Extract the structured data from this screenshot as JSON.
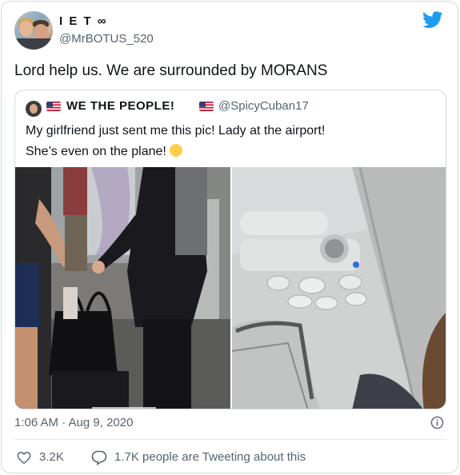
{
  "author": {
    "display_name": "I E T ∞",
    "handle": "@MrBOTUS_520",
    "avatar": "avatar-couple"
  },
  "brand_icon": "twitter-bird-icon",
  "tweet_text": "Lord help us. We are surrounded by MORANS",
  "quoted_tweet": {
    "display_name": "WE THE PEOPLE!",
    "flag_icon": "us-flag-icon",
    "handle": "@SpicyCuban17",
    "text_line1": "My girlfriend just sent me this pic!  Lady at the airport!",
    "text_line2": "She’s even on the plane!",
    "emoji": "rolling-on-floor-laughing-emoji",
    "photos": [
      "airport-lady-photo",
      "airplane-ceiling-photo"
    ]
  },
  "timestamp": "1:06 AM · Aug 9, 2020",
  "info_icon": "info-icon",
  "actions": {
    "likes": "3.2K",
    "replies_text": "1.7K people are Tweeting about this"
  },
  "colors": {
    "brand": "#1d9bf0",
    "text": "#0f1419",
    "secondary": "#536471",
    "border": "#cfd9de"
  }
}
